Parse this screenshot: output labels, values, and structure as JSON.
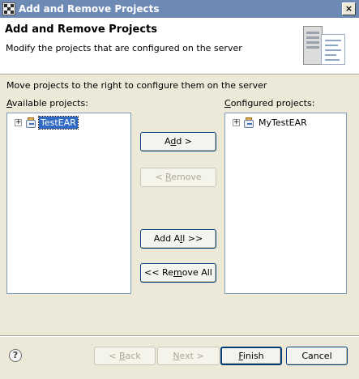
{
  "window": {
    "title": "Add and Remove Projects",
    "close_glyph": "×"
  },
  "banner": {
    "heading": "Add and Remove Projects",
    "description": "Modify the projects that are configured on the server"
  },
  "instruction": "Move projects to the right to configure them on the server",
  "available": {
    "label_mnemonic": "A",
    "label_rest": "vailable projects:",
    "items": [
      {
        "name": "TestEAR",
        "selected": true,
        "icon": "ear-project-icon"
      }
    ]
  },
  "configured": {
    "label_mnemonic": "C",
    "label_rest": "onfigured projects:",
    "items": [
      {
        "name": "MyTestEAR",
        "selected": false,
        "icon": "ear-project-icon"
      }
    ]
  },
  "actions": {
    "add": {
      "pre": "A",
      "mnemonic": "d",
      "post": "d >"
    },
    "remove": {
      "pre": "< ",
      "mnemonic": "R",
      "post": "emove"
    },
    "add_all": {
      "pre": "Add A",
      "mnemonic": "l",
      "post": "l >>"
    },
    "remove_all": {
      "pre": "<< Re",
      "mnemonic": "m",
      "post": "ove All"
    }
  },
  "footer": {
    "help_glyph": "?",
    "back": {
      "pre": "< ",
      "mnemonic": "B",
      "post": "ack"
    },
    "next": {
      "pre": "",
      "mnemonic": "N",
      "post": "ext >"
    },
    "finish": {
      "pre": "",
      "mnemonic": "F",
      "post": "inish"
    },
    "cancel": "Cancel"
  },
  "colors": {
    "titlebar": "#6d8ab5",
    "selection": "#316ac5",
    "dialog_bg": "#ece9d8"
  }
}
